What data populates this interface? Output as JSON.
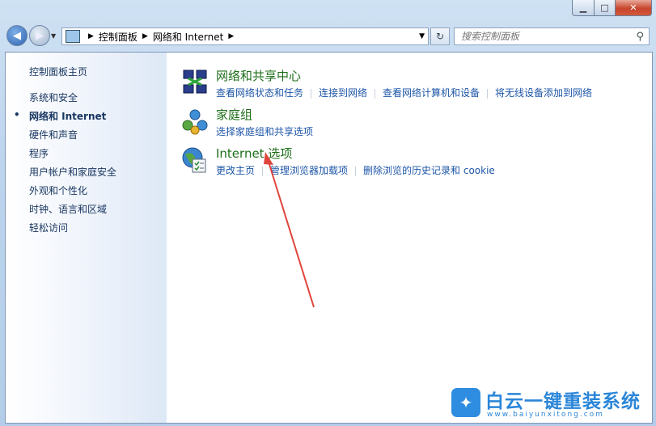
{
  "window": {
    "min_glyph": "▁",
    "max_glyph": "□",
    "close_glyph": "✕"
  },
  "address": {
    "crumbs": [
      "控制面板",
      "网络和 Internet"
    ]
  },
  "search": {
    "placeholder": "搜索控制面板"
  },
  "sidebar": {
    "home": "控制面板主页",
    "items": [
      {
        "label": "系统和安全"
      },
      {
        "label": "网络和 Internet"
      },
      {
        "label": "硬件和声音"
      },
      {
        "label": "程序"
      },
      {
        "label": "用户帐户和家庭安全"
      },
      {
        "label": "外观和个性化"
      },
      {
        "label": "时钟、语言和区域"
      },
      {
        "label": "轻松访问"
      }
    ]
  },
  "categories": [
    {
      "title": "网络和共享中心",
      "icon": "network-sharing-icon",
      "links": [
        "查看网络状态和任务",
        "连接到网络",
        "查看网络计算机和设备",
        "将无线设备添加到网络"
      ]
    },
    {
      "title": "家庭组",
      "icon": "homegroup-icon",
      "links": [
        "选择家庭组和共享选项"
      ]
    },
    {
      "title": "Internet 选项",
      "icon": "internet-options-icon",
      "links": [
        "更改主页",
        "管理浏览器加载项",
        "删除浏览的历史记录和 cookie"
      ]
    }
  ],
  "watermark": {
    "text": "白云一键重装系统",
    "url": "www.baiyunxitong.com"
  },
  "colors": {
    "category_title": "#1e6e1a",
    "link": "#1e56a8",
    "annotation_arrow": "#e0453c"
  }
}
